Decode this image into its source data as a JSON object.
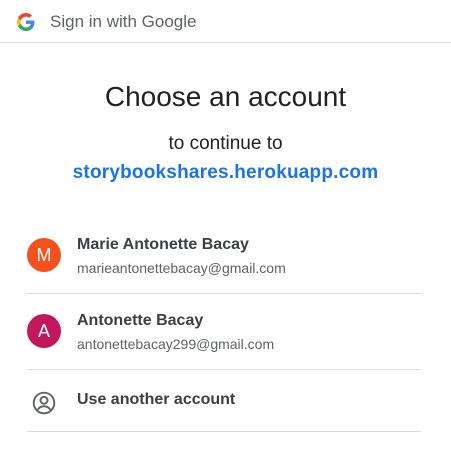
{
  "header": {
    "title": "Sign in with Google",
    "logo_icon": "google-g-icon"
  },
  "main": {
    "heading": "Choose an account",
    "subheading": "to continue to",
    "app_name": "storybookshares.herokuapp.com"
  },
  "accounts": [
    {
      "initial": "M",
      "name": "Marie Antonette Bacay",
      "email": "marieantonettebacay@gmail.com",
      "avatar_color": "#f4511e"
    },
    {
      "initial": "A",
      "name": "Antonette Bacay",
      "email": "antonettebacay299@gmail.com",
      "avatar_color": "#c2185b"
    }
  ],
  "other_account": {
    "label": "Use another account",
    "icon": "account-circle-icon"
  },
  "colors": {
    "link": "#1a73e8",
    "divider": "#dadce0"
  }
}
